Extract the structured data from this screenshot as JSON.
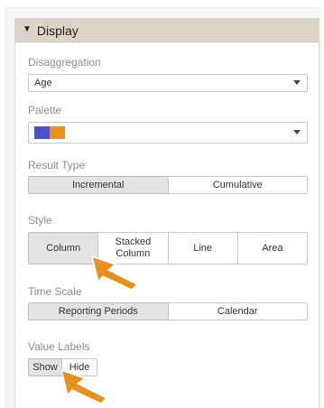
{
  "panel": {
    "title": "Display",
    "collapse_icon": "caret-down-icon"
  },
  "disaggregation": {
    "label": "Disaggregation",
    "value": "Age"
  },
  "palette": {
    "label": "Palette",
    "colors": [
      "#4a55c4",
      "#e8901e"
    ]
  },
  "result_type": {
    "label": "Result Type",
    "options": [
      "Incremental",
      "Cumulative"
    ],
    "selected": "Incremental"
  },
  "style": {
    "label": "Style",
    "options": [
      "Column",
      "Stacked\nColumn",
      "Line",
      "Area"
    ],
    "selected": "Column"
  },
  "time_scale": {
    "label": "Time Scale",
    "options": [
      "Reporting Periods",
      "Calendar"
    ],
    "selected": "Reporting Periods"
  },
  "value_labels": {
    "label": "Value Labels",
    "options": [
      "Show",
      "Hide"
    ],
    "selected": "Show"
  },
  "annotation_color": "#e8901e"
}
